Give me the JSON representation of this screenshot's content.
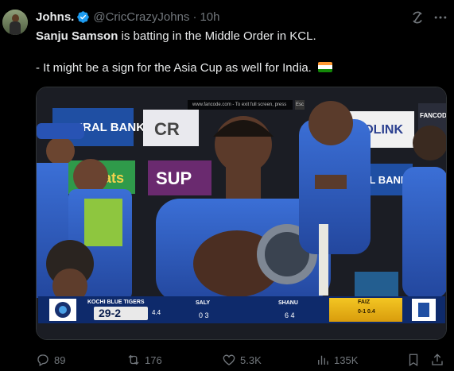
{
  "tweet": {
    "author_name": "Johns.",
    "handle": "@CricCrazyJohns",
    "separator": "·",
    "time": "10h",
    "text_bold": "Sanju Samson",
    "text_rest": " is batting in the Middle Order in KCL.",
    "text_line2": "- It might be a sign for the Asia Cup as well for India."
  },
  "media": {
    "overlay_text": "www.fancode.com - To exit full screen, press",
    "overlay_key": "Esc",
    "scoreboard": {
      "team": "KOCHI BLUE TIGERS",
      "score": "29-2",
      "overs": "4.4",
      "batter1": "SALY",
      "batter1_runs": "0 3",
      "batter2": "SHANU",
      "batter2_runs": "6 4",
      "bowler": "FAIZ",
      "bowler_figures": "0-1 0.4"
    },
    "hoardings": [
      "ERAL BANK",
      "CR",
      "ECOLINK",
      "Oats",
      "SUP",
      "AL BANK"
    ]
  },
  "actions": {
    "replies": "89",
    "reposts": "176",
    "likes": "5.3K",
    "views": "135K"
  },
  "colors": {
    "background": "#000000",
    "text": "#e7e9ea",
    "muted": "#71767b",
    "verified": "#1d9bf0",
    "scoreboard": "#0e2a6b",
    "bowler_box": "#f3c623"
  },
  "icons": [
    "verified-badge-icon",
    "grok-icon",
    "more-icon",
    "reply-icon",
    "repost-icon",
    "like-icon",
    "views-icon",
    "bookmark-icon",
    "share-icon"
  ]
}
